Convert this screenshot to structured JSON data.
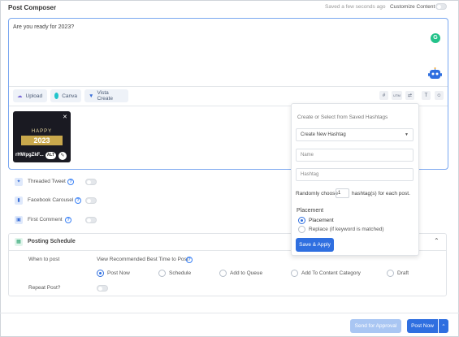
{
  "header": {
    "title": "Post Composer",
    "saved_status": "Saved a few seconds ago",
    "customize_label": "Customize Content"
  },
  "composer": {
    "text": "Are you ready for 2023?",
    "grammar_badge": "G",
    "toolbar": {
      "upload_label": "Upload",
      "canva_label": "Canva",
      "vista_label": "Vista Create",
      "hashtag_icon": "#",
      "utm_label": "UTM",
      "link_icon": "⇄",
      "text_icon": "T",
      "emoji_icon": "☺"
    },
    "media": {
      "happy": "HAPPY",
      "year": "2023",
      "filename": "rHWpgZkF...",
      "alt_badge": "ALT",
      "edit_icon": "✎",
      "close_icon": "✕"
    }
  },
  "options": [
    {
      "label": "Threaded Tweet",
      "icon": "twitter-icon",
      "glyph": "✦"
    },
    {
      "label": "Facebook Carousel",
      "icon": "carousel-icon",
      "glyph": "▮"
    },
    {
      "label": "First Comment",
      "icon": "comment-icon",
      "glyph": "▣"
    }
  ],
  "help_glyph": "?",
  "schedule": {
    "title": "Posting Schedule",
    "when_label": "When to post",
    "recommended_label": "View Recommended Best Time to Post",
    "choices": [
      "Post Now",
      "Schedule",
      "Add to Queue",
      "Add To Content Category",
      "Draft"
    ],
    "selected": "Post Now",
    "repeat_label": "Repeat Post?"
  },
  "hashtag_popup": {
    "title": "Create or Select from Saved Hashtags",
    "select_value": "Create New Hashtag",
    "name_placeholder": "Name",
    "hashtag_placeholder": "Hashtag",
    "random_prefix": "Randomly choose",
    "random_value": "1",
    "random_suffix": "hashtag(s) for each post.",
    "placement_title": "Placement",
    "placement_options": [
      "Placement",
      "Replace (if keyword is matched)"
    ],
    "placement_selected": "Placement",
    "save_button": "Save & Apply"
  },
  "footer": {
    "approval_button": "Send for Approval",
    "post_now_button": "Post Now",
    "dropdown_glyph": "⌃"
  },
  "colors": {
    "accent": "#2f6fe0",
    "approval_disabled": "#a9c6f3",
    "composer_border": "#7aa7f0",
    "grammar": "#23c28a"
  }
}
